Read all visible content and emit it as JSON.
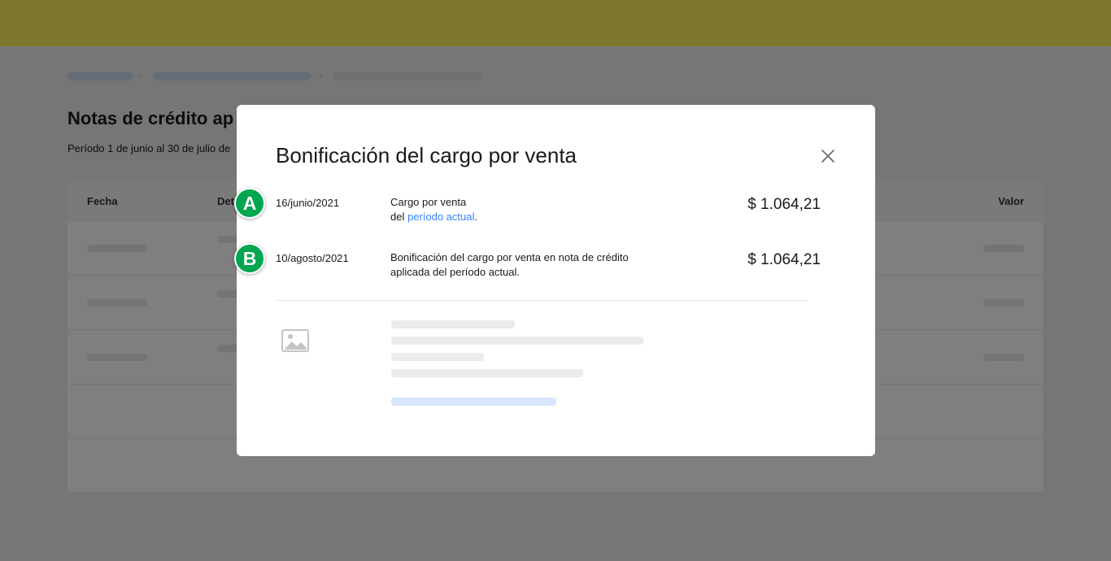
{
  "background": {
    "page_title": "Notas de crédito ap",
    "page_subtitle": "Período 1 de junio al 30 de julio de",
    "table_headers": {
      "fecha": "Fecha",
      "detalle": "Det",
      "valor": "Valor"
    }
  },
  "modal": {
    "title": "Bonificación del cargo por venta",
    "close_icon": "close-icon",
    "rows": [
      {
        "badge": "A",
        "date": "16/junio/2021",
        "desc_line1": "Cargo por venta",
        "desc_line2_prefix": "del",
        "desc_link": "período actual",
        "desc_line2_suffix": ".",
        "amount": "$ 1.064,21"
      },
      {
        "badge": "B",
        "date": "10/agosto/2021",
        "desc_line1": "Bonificación del cargo por venta en nota de crédito",
        "desc_line2": "aplicada del período actual.",
        "amount": "$ 1.064,21"
      }
    ],
    "placeholder_icon": "image-icon"
  },
  "colors": {
    "accent": "#3483fa",
    "topbar": "#fff159",
    "badge": "#00a650"
  }
}
